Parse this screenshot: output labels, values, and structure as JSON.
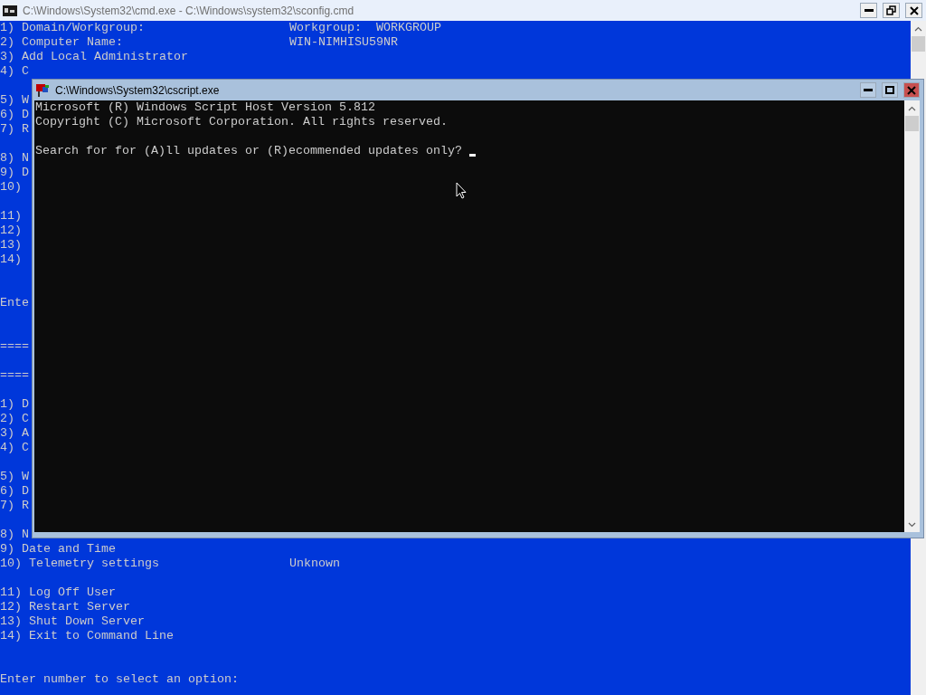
{
  "window": {
    "title": "C:\\Windows\\System32\\cmd.exe - C:\\Windows\\system32\\sconfig.cmd"
  },
  "console": {
    "lines": [
      {
        "kind": "text",
        "text": "1) Domain/Workgroup:",
        "value": "Workgroup:  WORKGROUP"
      },
      {
        "kind": "text",
        "text": "2) Computer Name:",
        "value": "WIN-NIMHISU59NR"
      },
      {
        "kind": "text",
        "text": "3) Add Local Administrator"
      },
      {
        "kind": "text",
        "text": "4) C"
      },
      {
        "kind": "blank"
      },
      {
        "kind": "text",
        "text": "5) W"
      },
      {
        "kind": "text",
        "text": "6) D"
      },
      {
        "kind": "text",
        "text": "7) R"
      },
      {
        "kind": "blank"
      },
      {
        "kind": "text",
        "text": "8) N"
      },
      {
        "kind": "text",
        "text": "9) D"
      },
      {
        "kind": "text",
        "text": "10)"
      },
      {
        "kind": "blank"
      },
      {
        "kind": "text",
        "text": "11)"
      },
      {
        "kind": "text",
        "text": "12)"
      },
      {
        "kind": "text",
        "text": "13)"
      },
      {
        "kind": "text",
        "text": "14)"
      },
      {
        "kind": "blank"
      },
      {
        "kind": "blank"
      },
      {
        "kind": "text",
        "text": "Ente"
      },
      {
        "kind": "blank"
      },
      {
        "kind": "blank"
      },
      {
        "kind": "text",
        "text": "===="
      },
      {
        "kind": "blank"
      },
      {
        "kind": "text",
        "text": "===="
      },
      {
        "kind": "blank"
      },
      {
        "kind": "text",
        "text": "1) D"
      },
      {
        "kind": "text",
        "text": "2) C"
      },
      {
        "kind": "text",
        "text": "3) A"
      },
      {
        "kind": "text",
        "text": "4) C"
      },
      {
        "kind": "blank"
      },
      {
        "kind": "text",
        "text": "5) W"
      },
      {
        "kind": "text",
        "text": "6) D"
      },
      {
        "kind": "text",
        "text": "7) R"
      },
      {
        "kind": "blank"
      },
      {
        "kind": "text",
        "text": "8) N"
      },
      {
        "kind": "text",
        "text": "9) Date and Time"
      },
      {
        "kind": "text",
        "text": "10) Telemetry settings",
        "value": "Unknown"
      },
      {
        "kind": "blank"
      },
      {
        "kind": "text",
        "text": "11) Log Off User"
      },
      {
        "kind": "text",
        "text": "12) Restart Server"
      },
      {
        "kind": "text",
        "text": "13) Shut Down Server"
      },
      {
        "kind": "text",
        "text": "14) Exit to Command Line"
      },
      {
        "kind": "blank"
      },
      {
        "kind": "blank"
      },
      {
        "kind": "text",
        "text": "Enter number to select an option:"
      }
    ]
  },
  "dialog": {
    "title": "C:\\Windows\\System32\\cscript.exe",
    "lines": [
      {
        "kind": "text",
        "text": "Microsoft (R) Windows Script Host Version 5.812"
      },
      {
        "kind": "text",
        "text": "Copyright (C) Microsoft Corporation. All rights reserved."
      },
      {
        "kind": "blank"
      },
      {
        "kind": "prompt",
        "text": "Search for for (A)ll updates or (R)ecommended updates only?"
      }
    ]
  }
}
